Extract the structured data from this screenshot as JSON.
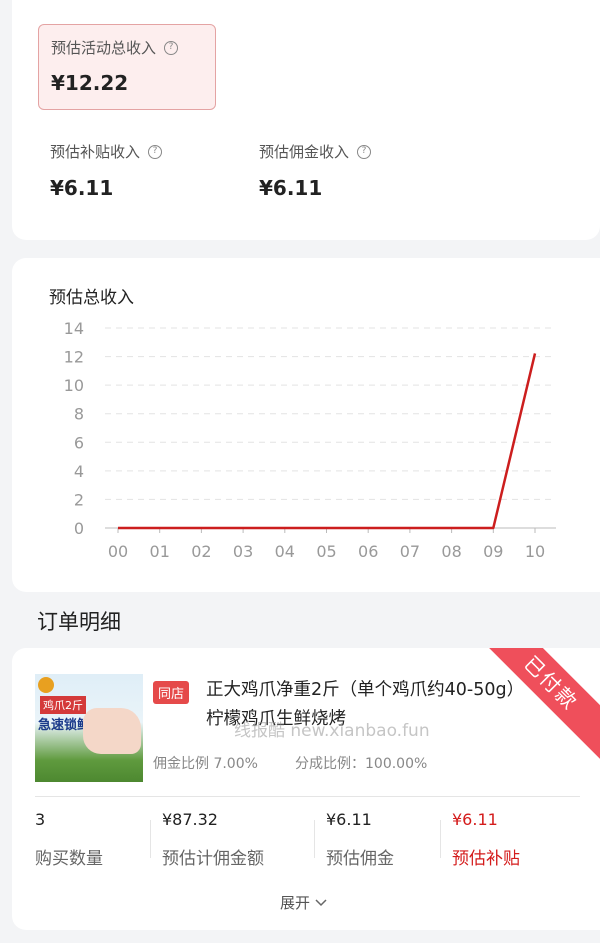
{
  "summary": {
    "total_label": "预估活动总收入",
    "total_value": "¥12.22",
    "subsidy_label": "预估补贴收入",
    "subsidy_value": "¥6.11",
    "commission_label": "预估佣金收入",
    "commission_value": "¥6.11"
  },
  "chart_data": {
    "type": "line",
    "title": "预估总收入",
    "x": [
      "00",
      "01",
      "02",
      "03",
      "04",
      "05",
      "06",
      "07",
      "08",
      "09",
      "10"
    ],
    "series": [
      {
        "values": [
          0,
          0,
          0,
          0,
          0,
          0,
          0,
          0,
          0,
          0,
          12.22
        ]
      }
    ],
    "yticks": [
      "0",
      "2",
      "4",
      "6",
      "8",
      "10",
      "12",
      "14"
    ],
    "ylim": [
      0,
      14
    ],
    "grid": true,
    "color": "#cc1e1e"
  },
  "orders": {
    "title": "订单明细",
    "item": {
      "tag": "同店",
      "name": "正大鸡爪净重2斤（单个鸡爪约40-50g） 柠檬鸡爪生鲜烧烤",
      "commission_ratio": "佣金比例 7.00%",
      "share_ratio": "分成比例：100.00%",
      "status": "已付款",
      "thumb_text_1": "鸡爪2斤",
      "thumb_text_2": "急速锁鲜",
      "stats": [
        {
          "value": "3",
          "label": "购买数量"
        },
        {
          "value": "¥87.32",
          "label": "预估计佣金额"
        },
        {
          "value": "¥6.11",
          "label": "预估佣金"
        },
        {
          "value": "¥6.11",
          "label": "预估补贴"
        }
      ],
      "expand_label": "展开"
    }
  },
  "watermark": "线报酷 new.xianbao.fun"
}
